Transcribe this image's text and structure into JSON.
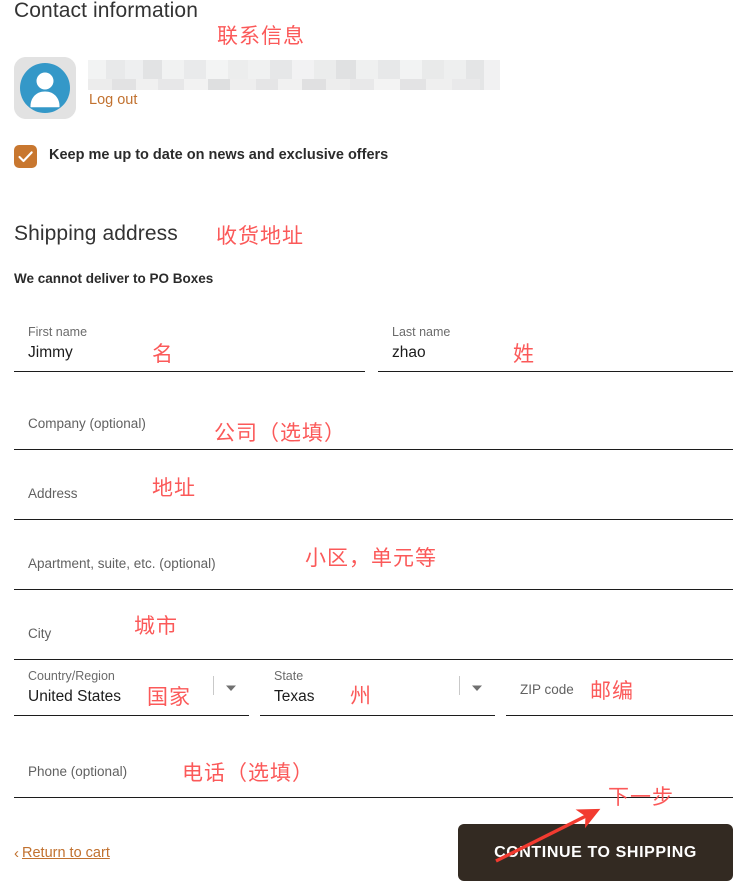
{
  "contact": {
    "title": "Contact information",
    "annotation": "联系信息",
    "logout_label": "Log out",
    "avatar_icon": "user-avatar-icon",
    "newsletter": {
      "checked": true,
      "label": "Keep me up to date on news and exclusive offers",
      "check_icon": "checkmark-icon"
    }
  },
  "shipping": {
    "title": "Shipping address",
    "annotation": "收货地址",
    "note": "We cannot deliver to PO Boxes",
    "fields": {
      "first_name": {
        "label": "First name",
        "value": "Jimmy",
        "annotation": "名"
      },
      "last_name": {
        "label": "Last name",
        "value": "zhao",
        "annotation": "姓"
      },
      "company": {
        "label": "Company (optional)",
        "value": "",
        "annotation": "公司（选填）"
      },
      "address": {
        "label": "Address",
        "value": "",
        "annotation": "地址"
      },
      "apartment": {
        "label": "Apartment, suite, etc. (optional)",
        "value": "",
        "annotation": "小区，单元等"
      },
      "city": {
        "label": "City",
        "value": "",
        "annotation": "城市"
      },
      "country": {
        "label": "Country/Region",
        "value": "United States",
        "annotation": "国家",
        "caret_icon": "chevron-down-icon"
      },
      "state": {
        "label": "State",
        "value": "Texas",
        "annotation": "州",
        "caret_icon": "chevron-down-icon"
      },
      "zip": {
        "label": "ZIP code",
        "value": "",
        "annotation": "邮编"
      },
      "phone": {
        "label": "Phone (optional)",
        "value": "",
        "annotation": "电话（选填）"
      }
    }
  },
  "footer": {
    "return_label": "Return to cart",
    "return_chevron_icon": "chevron-left-icon",
    "continue_label": "CONTINUE TO SHIPPING",
    "continue_annotation": "下一步",
    "arrow_icon": "red-arrow-icon"
  },
  "colors": {
    "accent_orange": "#c8772f",
    "link_orange": "#c1712f",
    "button_dark": "#332a22",
    "annotation_red": "#fb4b4b",
    "avatar_blue": "#3498c8",
    "field_underline": "#1c1c1c"
  }
}
